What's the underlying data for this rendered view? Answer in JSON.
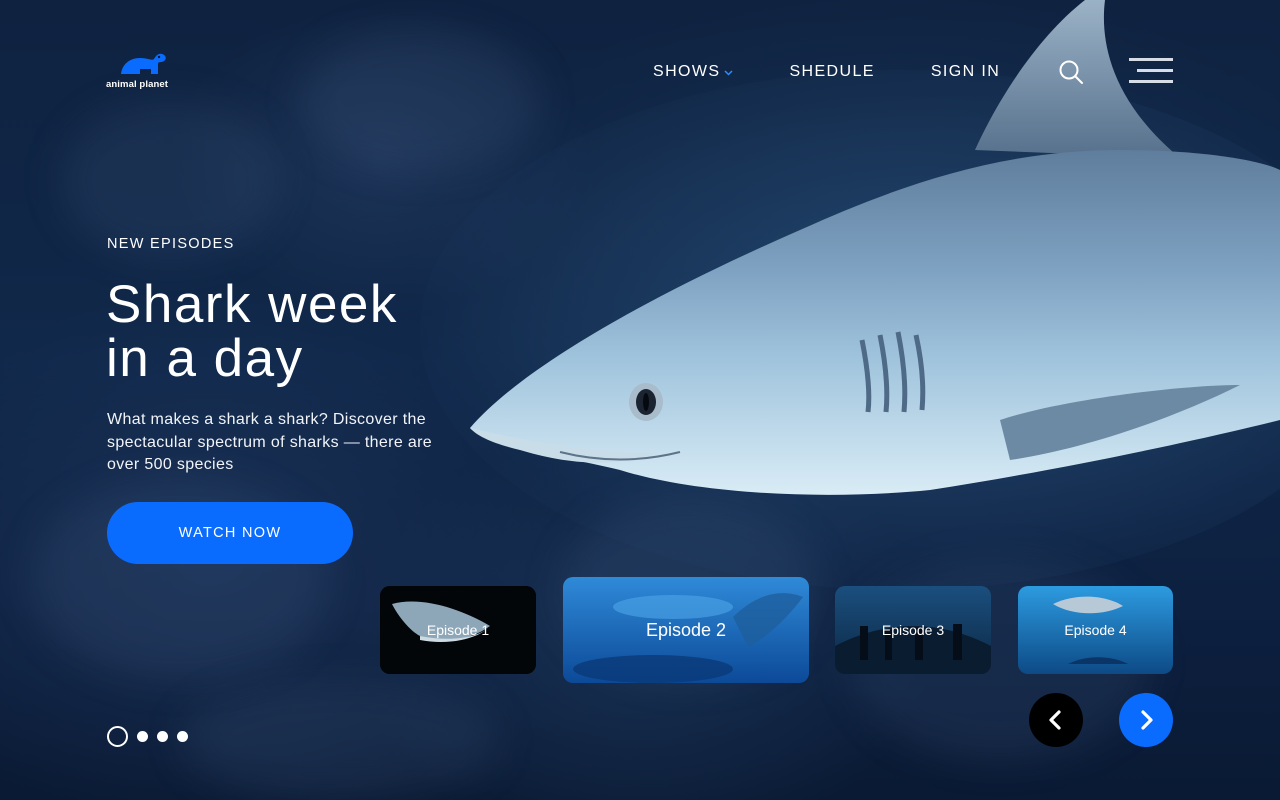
{
  "brand": {
    "name": "animal planet",
    "accent": "#0a6cff"
  },
  "nav": {
    "items": [
      {
        "label": "SHOWS",
        "has_dropdown": true
      },
      {
        "label": "SHEDULE"
      },
      {
        "label": "SIGN IN"
      }
    ],
    "icons": [
      "search-icon",
      "hamburger-menu-icon"
    ]
  },
  "hero": {
    "kicker": "NEW EPISODES",
    "title_line1": "Shark week",
    "title_line2": "in a day",
    "description": "What makes a shark a shark? Discover the spectacular spectrum of sharks — there are over 500 species",
    "cta_label": "WATCH NOW"
  },
  "episodes": [
    {
      "label": "Episode 1"
    },
    {
      "label": "Episode 2",
      "selected": true
    },
    {
      "label": "Episode 3"
    },
    {
      "label": "Episode 4"
    }
  ],
  "carousel": {
    "slide_count": 4,
    "active_slide": 1,
    "prev_icon": "chevron-left-icon",
    "next_icon": "chevron-right-icon"
  }
}
